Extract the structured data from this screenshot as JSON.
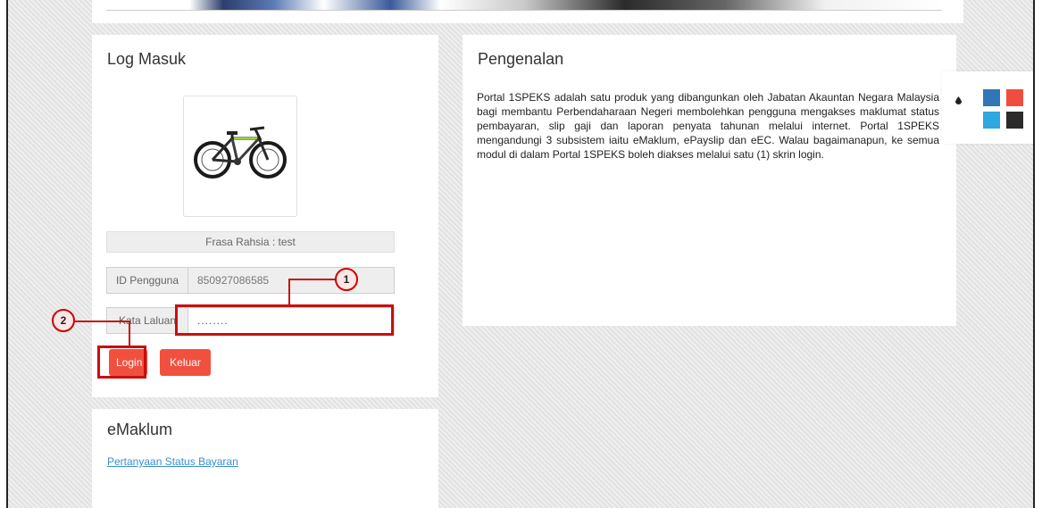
{
  "login": {
    "title": "Log Masuk",
    "secret_phrase": "Frasa Rahsia : test",
    "user_label": "ID Pengguna",
    "user_value": "850927086585",
    "password_label": "Kata Laluan",
    "password_value": "........",
    "login_button": "Login",
    "exit_button": "Keluar"
  },
  "intro": {
    "title": "Pengenalan",
    "body": "Portal 1SPEKS adalah satu produk yang dibangunkan oleh Jabatan Akauntan Negara Malaysia bagi membantu Perbendaharaan Negeri membolehkan pengguna mengakses maklumat status pembayaran, slip gaji dan laporan penyata tahunan melalui internet. Portal 1SPEKS mengandungi 3 subsistem iaitu eMaklum, ePayslip dan eEC. Walau bagaimanapun, ke semua modul di dalam Portal 1SPEKS boleh diakses melalui satu (1) skrin login."
  },
  "emaklum": {
    "title": "eMaklum",
    "link": "Pertanyaan Status Bayaran"
  },
  "annotations": {
    "badge1": "1",
    "badge2": "2"
  },
  "theme_colors": [
    "#3177b8",
    "#ef4e3e",
    "#2ea8e0",
    "#2b2b2b"
  ],
  "accent_color": "#f2503f"
}
